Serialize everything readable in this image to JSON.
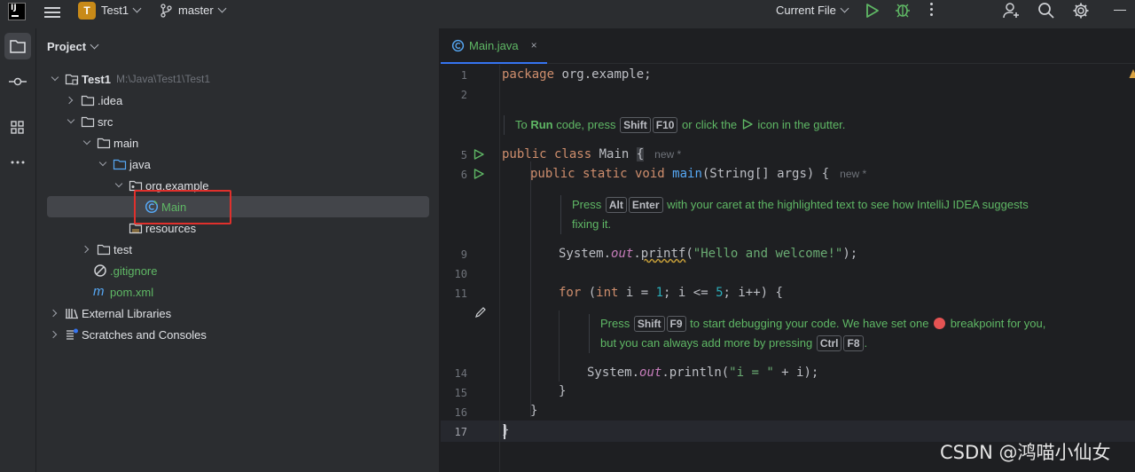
{
  "titlebar": {
    "logo_text": "IJ",
    "project_badge": "T",
    "project_name": "Test1",
    "branch": "master",
    "run_config": "Current File"
  },
  "project_panel": {
    "title": "Project",
    "tree": [
      {
        "label": "Test1",
        "hint": "M:\\Java\\Test1\\Test1",
        "bold": true
      },
      {
        "label": ".idea"
      },
      {
        "label": "src"
      },
      {
        "label": "main"
      },
      {
        "label": "java"
      },
      {
        "label": "org.example"
      },
      {
        "label": "Main"
      },
      {
        "label": "resources"
      },
      {
        "label": "test"
      },
      {
        "label": ".gitignore"
      },
      {
        "label": "pom.xml"
      },
      {
        "label": "External Libraries"
      },
      {
        "label": "Scratches and Consoles"
      }
    ]
  },
  "editor": {
    "tab_label": "Main.java",
    "tab_close": "×",
    "line_numbers": [
      "1",
      "2",
      "5",
      "6",
      "9",
      "10",
      "11",
      "14",
      "15",
      "16",
      "17"
    ],
    "inlay_new": "new *",
    "code": {
      "l1_kw": "package",
      "l1_rest": " org.example;",
      "l5_kw": "public class",
      "l5_rest": " Main ",
      "l5_brace": "{",
      "l6_kw": "public static void",
      "l6_fn": "main",
      "l6_rest": "(String[] args) {",
      "l9_pre": "System.",
      "l9_out": "out",
      "l9_dot": ".",
      "l9_fn": "printf",
      "l9_open": "(",
      "l9_str": "\"Hello and welcome!\"",
      "l9_close": ");",
      "l11_kw": "for",
      "l11_a": " (",
      "l11_int": "int",
      "l11_b": " i = ",
      "l11_n1": "1",
      "l11_c": "; i <= ",
      "l11_n2": "5",
      "l11_d": "; i++) {",
      "l14_pre": "System.",
      "l14_out": "out",
      "l14_mid": ".println(",
      "l14_str": "\"i = \"",
      "l14_end": " + i);",
      "l15": "}",
      "l16": "}",
      "l17": "}"
    },
    "doc1": {
      "t1": "To ",
      "run": "Run",
      "t2": " code, press ",
      "k1": "Shift",
      "k2": "F10",
      "t3": " or click the ",
      "t4": " icon in the gutter."
    },
    "doc2": {
      "t1": "Press ",
      "k1": "Alt",
      "k2": "Enter",
      "t2": " with your caret at the highlighted text to see how IntelliJ IDEA suggests",
      "t3": "fixing it."
    },
    "doc3": {
      "t1": "Press ",
      "k1": "Shift",
      "k2": "F9",
      "t2": " to start debugging your code. We have set one ",
      "t3": " breakpoint for you,",
      "t4": "but you can always add more by pressing ",
      "k3": "Ctrl",
      "k4": "F8",
      "t5": "."
    }
  },
  "watermark": "CSDN @鸿喵小仙女",
  "colors": {
    "accent": "#3574f0",
    "keyword": "#cf8e6d",
    "function": "#56a8f5",
    "string": "#6aab73",
    "number": "#2aacb8",
    "doc_green": "#5fb865",
    "highlight_box": "#e0302c"
  }
}
